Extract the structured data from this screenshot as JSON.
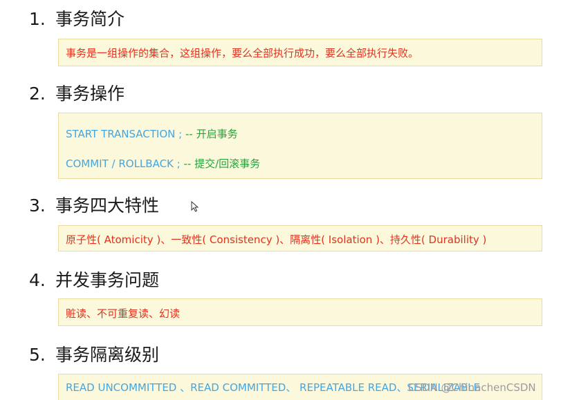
{
  "sections": [
    {
      "number": "1.",
      "title": "事务简介"
    },
    {
      "number": "2.",
      "title": "事务操作"
    },
    {
      "number": "3.",
      "title": "事务四大特性"
    },
    {
      "number": "4.",
      "title": "并发事务问题"
    },
    {
      "number": "5.",
      "title": "事务隔离级别"
    }
  ],
  "intro_text": "事务是一组操作的集合，这组操作，要么全部执行成功，要么全部执行失败。",
  "operations": [
    {
      "code": "START TRANSACTION ;",
      "comment": "-- 开启事务"
    },
    {
      "code": "COMMIT / ROLLBACK ;",
      "comment": "-- 提交/回滚事务"
    }
  ],
  "acid_text": "原子性( Atomicity )、一致性( Consistency )、隔离性( Isolation )、持久性( Durability )",
  "problems_text": "赃读、不可重复读、幻读",
  "isolation_text": "READ UNCOMMITTED 、READ COMMITTED、 REPEATABLE READ、SERIALIZABLE",
  "watermark": "CSDN @ChinachenCSDN",
  "colors": {
    "box_bg": "#fcf8dc",
    "red_text": "#e0321e",
    "blue_code": "#43a6e0",
    "green_comment": "#22a43a"
  }
}
